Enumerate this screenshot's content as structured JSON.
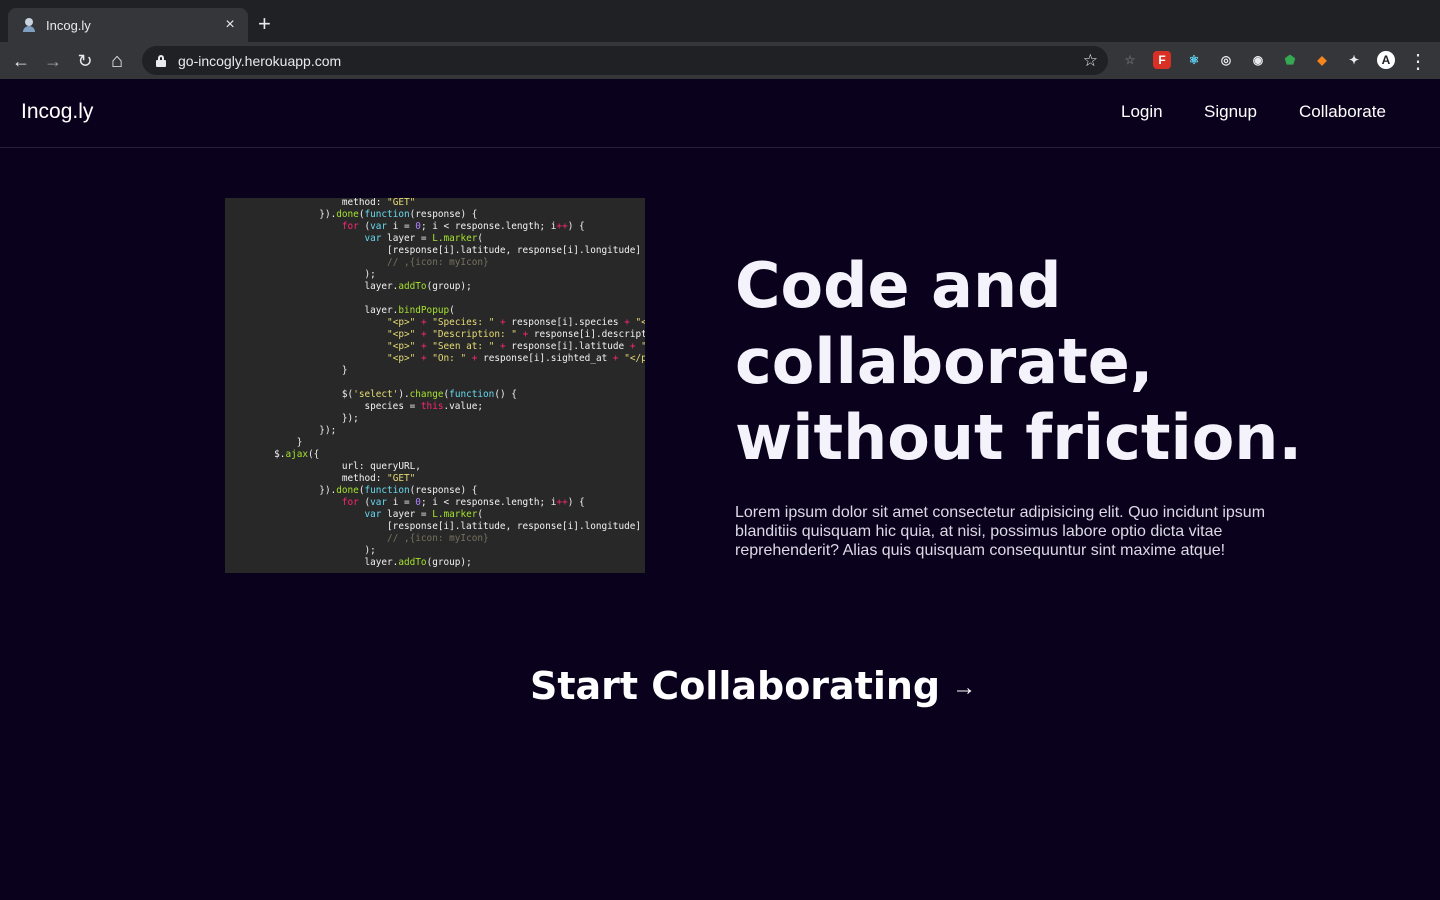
{
  "browser": {
    "tab_title": "Incog.ly",
    "tab_close": "×",
    "new_tab": "+",
    "url": "go-incogly.herokuapp.com",
    "back": "←",
    "forward": "→",
    "reload": "↻",
    "home": "⌂",
    "bookmark": "☆",
    "menu": "⋮",
    "extensions": [
      {
        "name": "star-outline-icon",
        "glyph": "☆",
        "color": "#5f6368",
        "bg": "transparent"
      },
      {
        "name": "f-extension-icon",
        "glyph": "F",
        "color": "#ffffff",
        "bg": "#d93025"
      },
      {
        "name": "react-devtools-icon",
        "glyph": "⚛",
        "color": "#61dafb",
        "bg": "transparent"
      },
      {
        "name": "target-extension-icon",
        "glyph": "◎",
        "color": "#e8eaed",
        "bg": "transparent"
      },
      {
        "name": "chat-extension-icon",
        "glyph": "◉",
        "color": "#e8eaed",
        "bg": "transparent"
      },
      {
        "name": "green-extension-icon",
        "glyph": "⬟",
        "color": "#34a853",
        "bg": "transparent"
      },
      {
        "name": "metamask-fox-icon",
        "glyph": "◆",
        "color": "#f6851b",
        "bg": "transparent"
      },
      {
        "name": "puzzle-extensions-icon",
        "glyph": "✦",
        "color": "#e8eaed",
        "bg": "transparent"
      },
      {
        "name": "profile-avatar-icon",
        "glyph": "A",
        "color": "#202124",
        "bg": "#ffffff"
      }
    ]
  },
  "nav": {
    "brand": "Incog.ly",
    "links": [
      "Login",
      "Signup",
      "Collaborate"
    ]
  },
  "hero": {
    "headline": "Code and collaborate, without friction.",
    "description": "Lorem ipsum dolor sit amet consectetur adipisicing elit. Quo incidunt ipsum blanditiis quisquam hic quia, at nisi, possimus labore optio dicta vitae reprehenderit? Alias quis quisquam consequuntur sint maxime atque!",
    "cta": "Start Collaborating",
    "cta_arrow": "→"
  },
  "colors": {
    "page_bg": "#0a021c",
    "chrome_bg": "#35363a",
    "tabstrip_bg": "#202124"
  }
}
